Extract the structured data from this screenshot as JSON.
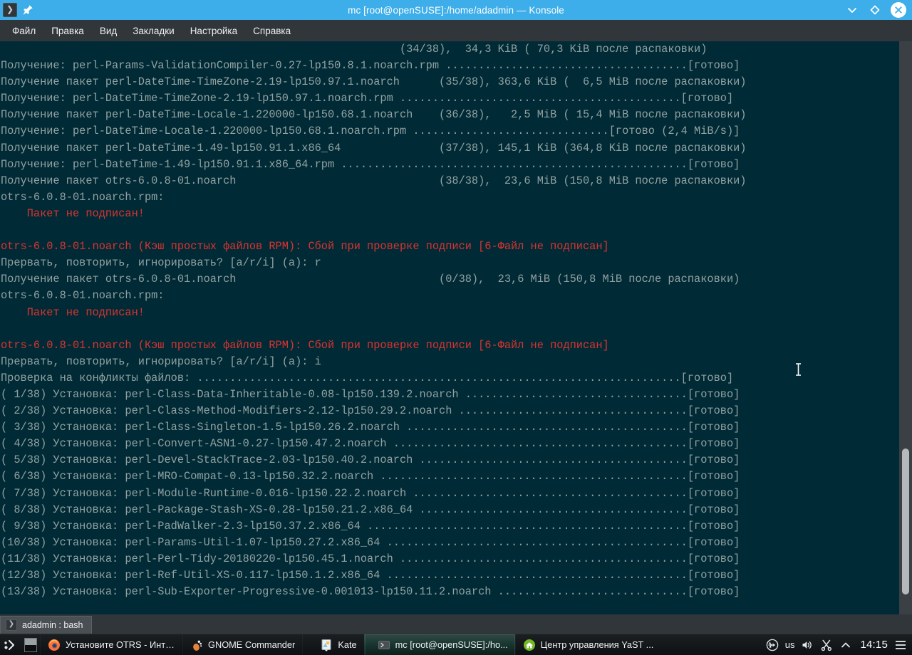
{
  "window": {
    "title": "mc [root@openSUSE]:/home/adadmin — Konsole",
    "app_icon": "terminal-icon",
    "pin_icon": "pin-icon",
    "minimize_icon": "chevron-down-icon",
    "maximize_icon": "diamond-icon",
    "close_icon": "close-icon",
    "accent_color": "#3daee9"
  },
  "menubar": {
    "items": [
      {
        "label": "Файл",
        "name": "menu-file"
      },
      {
        "label": "Правка",
        "name": "menu-edit"
      },
      {
        "label": "Вид",
        "name": "menu-view"
      },
      {
        "label": "Закладки",
        "name": "menu-bookmarks"
      },
      {
        "label": "Настройка",
        "name": "menu-settings"
      },
      {
        "label": "Справка",
        "name": "menu-help"
      }
    ]
  },
  "terminal": {
    "background_color": "#002b36",
    "foreground_color": "#93a1a1",
    "error_color": "#dc322f",
    "cursor_icon": "i-beam-cursor",
    "lines": [
      {
        "text": "                                                             (34/38),  34,3 KiB ( 70,3 KiB после распаковки)",
        "color": "normal"
      },
      {
        "text": "Получение: perl-Params-ValidationCompiler-0.27-lp150.8.1.noarch.rpm .....................................[готово]",
        "color": "normal"
      },
      {
        "text": "Получение пакет perl-DateTime-TimeZone-2.19-lp150.97.1.noarch      (35/38), 363,6 KiB (  6,5 MiB после распаковки)",
        "color": "normal"
      },
      {
        "text": "Получение: perl-DateTime-TimeZone-2.19-lp150.97.1.noarch.rpm ...........................................[готово]",
        "color": "normal"
      },
      {
        "text": "Получение пакет perl-DateTime-Locale-1.220000-lp150.68.1.noarch    (36/38),   2,5 MiB ( 15,4 MiB после распаковки)",
        "color": "normal"
      },
      {
        "text": "Получение: perl-DateTime-Locale-1.220000-lp150.68.1.noarch.rpm ..............................[готово (2,4 MiB/s)]",
        "color": "normal"
      },
      {
        "text": "Получение пакет perl-DateTime-1.49-lp150.91.1.x86_64               (37/38), 145,1 KiB (364,8 KiB после распаковки)",
        "color": "normal"
      },
      {
        "text": "Получение: perl-DateTime-1.49-lp150.91.1.x86_64.rpm .....................................................[готово]",
        "color": "normal"
      },
      {
        "text": "Получение пакет otrs-6.0.8-01.noarch                               (38/38),  23,6 MiB (150,8 MiB после распаковки)",
        "color": "normal"
      },
      {
        "text": "otrs-6.0.8-01.noarch.rpm:",
        "color": "normal"
      },
      {
        "text": "    Пакет не подписан!",
        "color": "red"
      },
      {
        "text": "",
        "color": "normal"
      },
      {
        "text": "otrs-6.0.8-01.noarch (Кэш простых файлов RPM): Сбой при проверке подписи [6-Файл не подписан]",
        "color": "red"
      },
      {
        "text": "Прервать, повторить, игнорировать? [a/r/i] (a): r",
        "color": "normal"
      },
      {
        "text": "Получение пакет otrs-6.0.8-01.noarch                               (0/38),  23,6 MiB (150,8 MiB после распаковки)",
        "color": "normal"
      },
      {
        "text": "otrs-6.0.8-01.noarch.rpm:",
        "color": "normal"
      },
      {
        "text": "    Пакет не подписан!",
        "color": "red"
      },
      {
        "text": "",
        "color": "normal"
      },
      {
        "text": "otrs-6.0.8-01.noarch (Кэш простых файлов RPM): Сбой при проверке подписи [6-Файл не подписан]",
        "color": "red"
      },
      {
        "text": "Прервать, повторить, игнорировать? [a/r/i] (a): i",
        "color": "normal"
      },
      {
        "text": "Проверка на конфликты файлов: ..........................................................................[готово]",
        "color": "normal"
      },
      {
        "text": "( 1/38) Установка: perl-Class-Data-Inheritable-0.08-lp150.139.2.noarch ..................................[готово]",
        "color": "normal"
      },
      {
        "text": "( 2/38) Установка: perl-Class-Method-Modifiers-2.12-lp150.29.2.noarch ...................................[готово]",
        "color": "normal"
      },
      {
        "text": "( 3/38) Установка: perl-Class-Singleton-1.5-lp150.26.2.noarch ...........................................[готово]",
        "color": "normal"
      },
      {
        "text": "( 4/38) Установка: perl-Convert-ASN1-0.27-lp150.47.2.noarch .............................................[готово]",
        "color": "normal"
      },
      {
        "text": "( 5/38) Установка: perl-Devel-StackTrace-2.03-lp150.40.2.noarch .........................................[готово]",
        "color": "normal"
      },
      {
        "text": "( 6/38) Установка: perl-MRO-Compat-0.13-lp150.32.2.noarch ...............................................[готово]",
        "color": "normal"
      },
      {
        "text": "( 7/38) Установка: perl-Module-Runtime-0.016-lp150.22.2.noarch ..........................................[готово]",
        "color": "normal"
      },
      {
        "text": "( 8/38) Установка: perl-Package-Stash-XS-0.28-lp150.21.2.x86_64 .........................................[готово]",
        "color": "normal"
      },
      {
        "text": "( 9/38) Установка: perl-PadWalker-2.3-lp150.37.2.x86_64 .................................................[готово]",
        "color": "normal"
      },
      {
        "text": "(10/38) Установка: perl-Params-Util-1.07-lp150.27.2.x86_64 ..............................................[готово]",
        "color": "normal"
      },
      {
        "text": "(11/38) Установка: perl-Perl-Tidy-20180220-lp150.45.1.noarch ............................................[готово]",
        "color": "normal"
      },
      {
        "text": "(12/38) Установка: perl-Ref-Util-XS-0.117-lp150.1.2.x86_64 ..............................................[готово]",
        "color": "normal"
      },
      {
        "text": "(13/38) Установка: perl-Sub-Exporter-Progressive-0.001013-lp150.11.2.noarch .............................[готово]",
        "color": "normal"
      }
    ]
  },
  "tabbar": {
    "tabs": [
      {
        "label": "adadmin : bash",
        "icon": "terminal-icon",
        "active": true
      }
    ]
  },
  "taskbar": {
    "launcher_icon": "kickoff-launcher-icon",
    "pager_icon": "show-desktop-icon",
    "tasks": [
      {
        "label": "Установите OTRS - Интр...",
        "icon": "firefox-icon",
        "active": false
      },
      {
        "label": "GNOME Commander",
        "icon": "gnome-foot-icon",
        "active": false
      },
      {
        "label": "Kate",
        "icon": "kate-icon",
        "active": false
      },
      {
        "label": "mc [root@openSUSE]:/ho...",
        "icon": "terminal-icon",
        "active": true
      },
      {
        "label": "Центр управления YaST ...",
        "icon": "yast-icon",
        "active": false
      }
    ],
    "tray": {
      "usb_icon": "usb-device-icon",
      "keyboard_layout": "us",
      "volume_icon": "speaker-icon",
      "clipboard_icon": "scissors-icon",
      "expand_icon": "chevron-up-icon",
      "clock": "14:15",
      "menu_icon": "hamburger-menu-icon"
    }
  }
}
